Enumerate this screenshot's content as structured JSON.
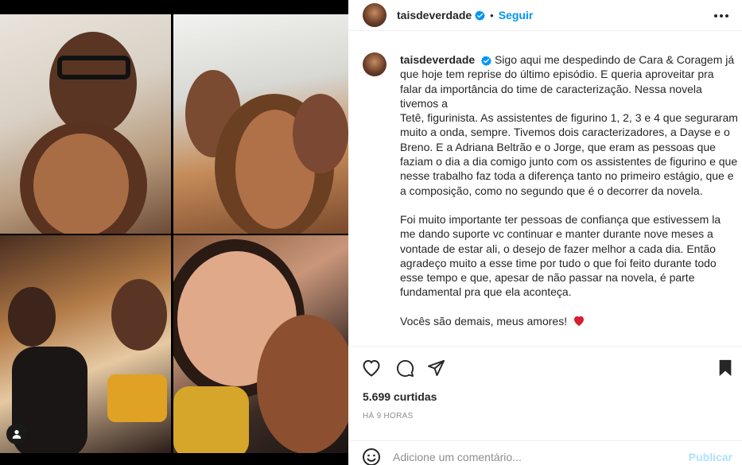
{
  "post": {
    "username": "taisdeverdade",
    "separator": "•",
    "follow_label": "Seguir",
    "verified_icon": "verified-badge-icon",
    "more_icon": "more-options-icon"
  },
  "caption": {
    "username": "taisdeverdade",
    "paragraph_1": "Sigo aqui me despedindo de Cara & Coragem já que hoje tem reprise do último episódio. E queria aproveitar pra falar da importância do time de caracterização. Nessa novela tivemos a",
    "paragraph_1b": "Tetê, figurinista. As assistentes de figurino 1, 2, 3 e 4 que seguraram muito a onda, sempre. Tivemos dois caracterizadores, a Dayse e o Breno. E a Adriana Beltrão e o Jorge, que eram as pessoas que faziam o dia a dia comigo junto com os assistentes de figurino e que nesse trabalho faz toda a diferença tanto no primeiro estágio, que e a composição, como no segundo que é o decorrer da novela.",
    "paragraph_2": "Foi muito importante ter pessoas de confiança que estivessem la me dando suporte vc continuar e manter durante nove meses a vontade de estar ali, o desejo de fazer melhor a cada dia. Então agradeço muito a esse time por tudo o que foi feito durante todo esse tempo e que, apesar de não passar na novela, é parte fundamental pra que ela aconteça.",
    "paragraph_3": "Vocês são demais, meus amores!",
    "heart_icon": "red-heart-emoji-icon"
  },
  "actions": {
    "like_icon": "heart-outline-icon",
    "comment_icon": "comment-bubble-icon",
    "share_icon": "paper-plane-icon",
    "save_icon": "bookmark-filled-icon",
    "likes_text": "5.699 curtidas",
    "time_text": "HÁ 9 HORAS"
  },
  "comment_box": {
    "emoji_icon": "smiley-face-icon",
    "placeholder": "Adicione um comentário...",
    "publish_label": "Publicar"
  },
  "media": {
    "user_tag_icon": "user-tag-icon"
  },
  "colors": {
    "accent": "#0095f6",
    "publish_disabled": "#b2dffc",
    "heart": "#ed4956",
    "muted": "#8e8e8e"
  }
}
